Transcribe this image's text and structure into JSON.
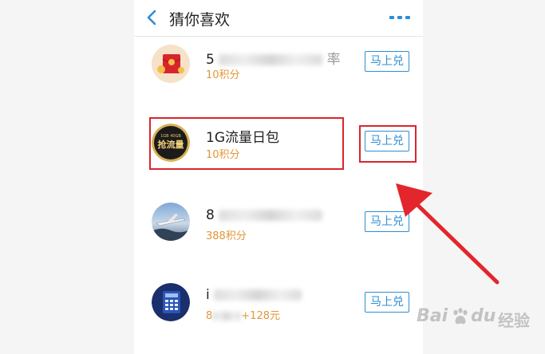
{
  "header": {
    "title": "猜你喜欢",
    "back_icon": "chevron-left-icon",
    "more_icon": "more-dots-icon",
    "accent": "#2d8ed6"
  },
  "items": [
    {
      "name_visible": "5",
      "name_tail": "率",
      "price": "10积分",
      "button": "马上兑",
      "avatar_icon": "red-envelope-icon"
    },
    {
      "name": "1G流量日包",
      "price": "10积分",
      "button": "马上兑",
      "avatar_icon": "data-plan-badge-icon",
      "badge_top": "1GB 40GB",
      "badge_main": "抢流量"
    },
    {
      "name_visible": "8",
      "price": "388积分",
      "button": "马上兑",
      "avatar_icon": "airplane-icon"
    },
    {
      "name_visible": "i",
      "price_visible": "+128元",
      "price_prefix": "8",
      "button": "马上兑",
      "avatar_icon": "calculator-icon"
    }
  ],
  "colors": {
    "price": "#e3963a",
    "highlight": "#d9262b"
  },
  "watermark": {
    "brand": "Bai",
    "paw_icon": "baidu-paw-icon",
    "du": "du",
    "suffix": "经验"
  }
}
